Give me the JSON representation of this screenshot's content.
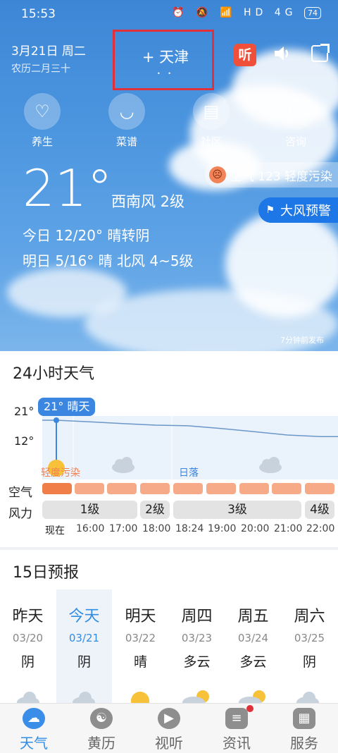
{
  "status_bar": {
    "time": "15:53",
    "icons": "⏰ 🔕 📶 HD 4G",
    "battery": "74"
  },
  "header": {
    "date": "3月21日 周二",
    "lunar": "农历二月三十",
    "city": "+ 天津",
    "page_dots": "• •",
    "listen_label": "听",
    "speaker_icon": "speaker-icon",
    "share_icon": "share-icon"
  },
  "quick_actions": [
    {
      "label": "养生",
      "icon": "heart-hands-icon"
    },
    {
      "label": "菜谱",
      "icon": "bowl-icon"
    },
    {
      "label": "社区",
      "icon": "chat-icon"
    },
    {
      "label": "咨询",
      "icon": "headset-icon"
    }
  ],
  "current": {
    "temperature": "21°",
    "wind": "西南风 2级",
    "today": "今日 12/20° 晴转阴",
    "tomorrow": "明日 5/16° 晴 北风 4~5级",
    "aqi": "空气 123 轻度污染",
    "alert": "大风预警",
    "published": "7分钟前发布"
  },
  "hourly": {
    "title": "24小时天气",
    "y_high": "21°",
    "y_low": "12°",
    "badge": "21° 晴天",
    "pollution_label": "轻度污染",
    "sunset_label": "日落",
    "air_label": "空气",
    "wind_label": "风力",
    "wind_levels": [
      "1级",
      "2级",
      "3级",
      "4级"
    ],
    "times": [
      "现在",
      "16:00",
      "17:00",
      "18:00",
      "18:24",
      "19:00",
      "20:00",
      "21:00",
      "22:00"
    ]
  },
  "chart_data": {
    "type": "line",
    "x": [
      "现在",
      "16:00",
      "17:00",
      "18:00",
      "18:24",
      "19:00",
      "20:00",
      "21:00",
      "22:00"
    ],
    "series": [
      {
        "values": [
          21,
          20.5,
          20,
          19.5,
          19.3,
          18.5,
          17.5,
          16.5,
          16
        ]
      }
    ],
    "yticks": [
      "21°",
      "12°"
    ],
    "ylim": [
      12,
      21
    ]
  },
  "forecast": {
    "title": "15日预报",
    "days": [
      {
        "name": "昨天",
        "date": "03/20",
        "weather": "阴",
        "highlight": false
      },
      {
        "name": "今天",
        "date": "03/21",
        "weather": "阴",
        "highlight": true
      },
      {
        "name": "明天",
        "date": "03/22",
        "weather": "晴",
        "highlight": false
      },
      {
        "name": "周四",
        "date": "03/23",
        "weather": "多云",
        "highlight": false
      },
      {
        "name": "周五",
        "date": "03/24",
        "weather": "多云",
        "highlight": false
      },
      {
        "name": "周六",
        "date": "03/25",
        "weather": "阴",
        "highlight": false
      }
    ]
  },
  "nav": [
    {
      "label": "天气",
      "icon": "cloud-icon",
      "active": true
    },
    {
      "label": "黄历",
      "icon": "yin-yang-icon",
      "active": false
    },
    {
      "label": "视听",
      "icon": "play-icon",
      "active": false
    },
    {
      "label": "资讯",
      "icon": "news-icon",
      "active": false
    },
    {
      "label": "服务",
      "icon": "grid-icon",
      "active": false
    }
  ],
  "colors": {
    "accent": "#2f8de4",
    "alert": "#1e77e6",
    "listen": "#f0503a",
    "city_box": "#e0303a",
    "aq_bar": "#f7aa88"
  }
}
